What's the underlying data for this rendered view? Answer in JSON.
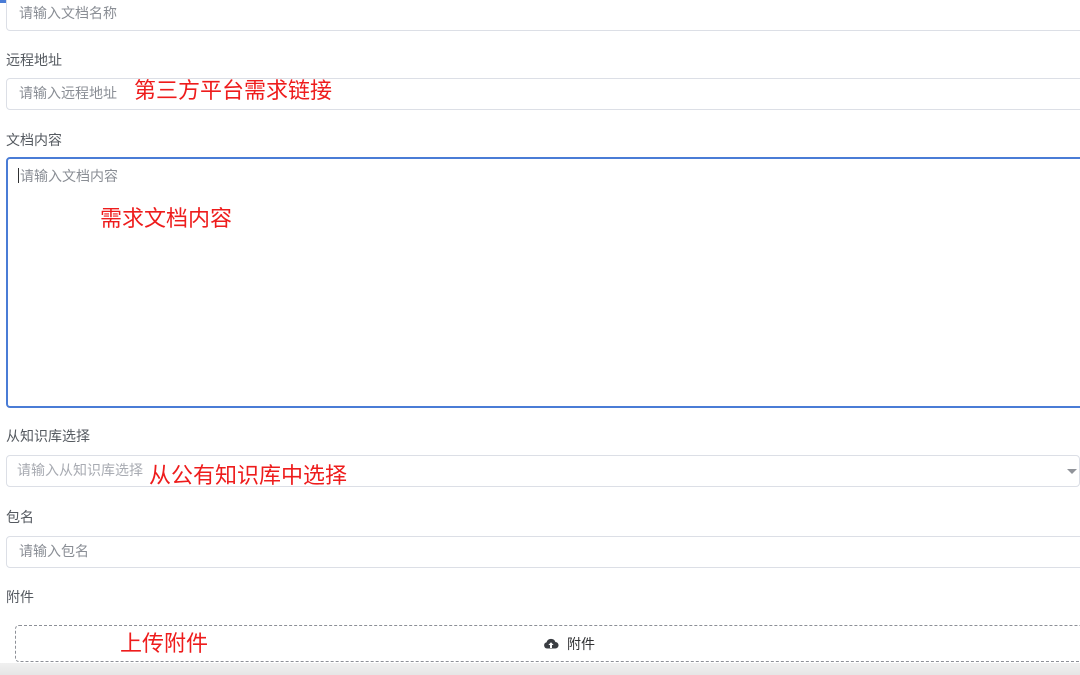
{
  "form": {
    "doc_name": {
      "placeholder": "请输入文档名称"
    },
    "remote_url": {
      "label": "远程地址",
      "placeholder": "请输入远程地址"
    },
    "doc_content": {
      "label": "文档内容",
      "placeholder": "请输入文档内容"
    },
    "knowledge_base": {
      "label": "从知识库选择",
      "placeholder": "请输入从知识库选择"
    },
    "package_name": {
      "label": "包名",
      "placeholder": "请输入包名"
    },
    "attachment": {
      "label": "附件",
      "button_label": "附件",
      "icon": "cloud-upload-icon"
    }
  },
  "annotations": {
    "remote_url": "第三方平台需求链接",
    "doc_content": "需求文档内容",
    "knowledge_base": "从公有知识库中选择",
    "attachment": "上传附件"
  },
  "colors": {
    "accent": "#4a7cd6",
    "annotation": "#ee1c1c",
    "border": "#dcdfe6"
  }
}
